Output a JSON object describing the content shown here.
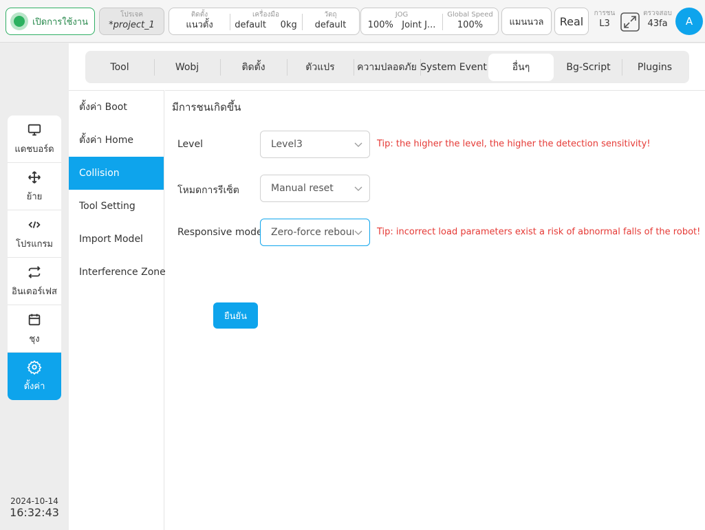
{
  "topbar": {
    "power_label": "เปิดการใช้งาน",
    "project": {
      "label": "โปรเจค",
      "value": "*project_1"
    },
    "install": {
      "label": "ติดตั้ง",
      "value": "แนวตั้ง"
    },
    "tool": {
      "label": "เครื่องมือ",
      "value": "default",
      "weight": "0kg"
    },
    "object": {
      "label": "วัตถุ",
      "value": "default"
    },
    "jog": {
      "label": "JOG",
      "value": "100%",
      "mode": "Joint J..."
    },
    "global_speed": {
      "label": "Global Speed",
      "value": "100%"
    },
    "manual_label": "แมนนวล",
    "real_label": "Real",
    "collision": {
      "label": "การชน",
      "value": "L3"
    },
    "check": {
      "label": "ตรวจสอบ",
      "value": "43fa"
    },
    "avatar_initial": "A"
  },
  "leftnav": {
    "items": [
      {
        "label": "แดชบอร์ด",
        "icon": "monitor-icon"
      },
      {
        "label": "ย้าย",
        "icon": "move-icon"
      },
      {
        "label": "โปรแกรม",
        "icon": "code-icon"
      },
      {
        "label": "อินเตอร์เฟส",
        "icon": "interface-icon"
      },
      {
        "label": "ชุง",
        "icon": "calendar-icon"
      },
      {
        "label": "ตั้งค่า",
        "icon": "gear-icon"
      }
    ],
    "active_index": 5,
    "date": "2024-10-14",
    "time": "16:32:43"
  },
  "tabs": [
    "Tool",
    "Wobj",
    "ติดตั้ง",
    "ตัวแปร",
    "ความปลอดภัย",
    "System Event",
    "อื่นๆ",
    "Bg-Script",
    "Plugins"
  ],
  "active_tab": "อื่นๆ",
  "submenu": [
    "ตั้งค่า Boot",
    "ตั้งค่า Home",
    "Collision",
    "Tool Setting",
    "Import Model",
    "Interference Zone"
  ],
  "active_submenu": "Collision",
  "content": {
    "title": "มีการชนเกิดขึ้น",
    "level": {
      "label": "Level",
      "value": "Level3",
      "tip": "Tip: the higher the level, the higher the detection sensitivity!"
    },
    "reset_mode": {
      "label": "โหมดการรีเซ็ต",
      "value": "Manual reset"
    },
    "responsive_mode": {
      "label": "Responsive mode",
      "value": "Zero-force rebound",
      "tip": "Tip: incorrect load parameters exist a risk of abnormal falls of the robot!"
    },
    "confirm_label": "ยืนยัน"
  },
  "colors": {
    "accent": "#0ea4ec",
    "power_green": "#2bb15f",
    "tip_red": "#e53935"
  }
}
